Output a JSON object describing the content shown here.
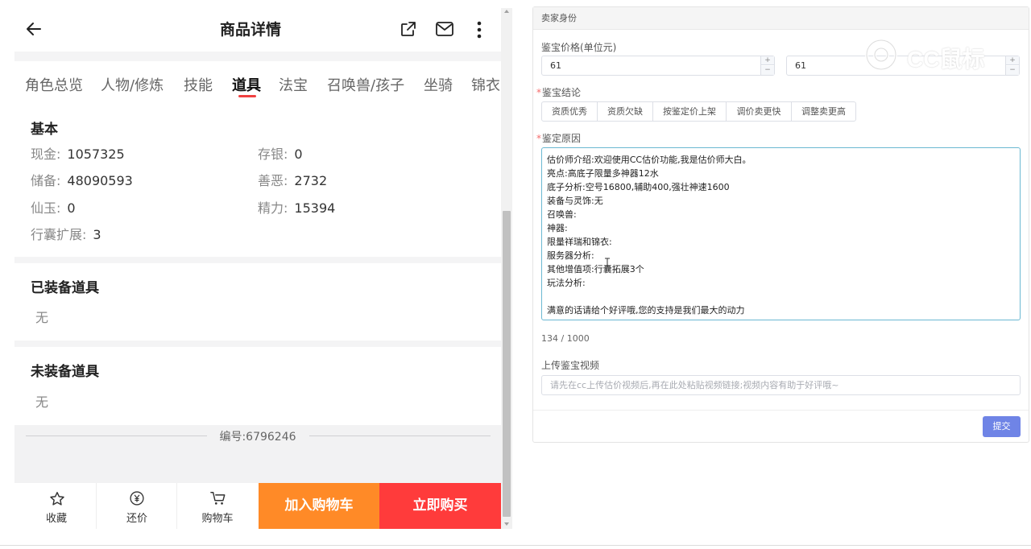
{
  "mobile": {
    "header": {
      "title": "商品详情"
    },
    "tabs": [
      {
        "label": "角色总览"
      },
      {
        "label": "人物/修炼"
      },
      {
        "label": "技能"
      },
      {
        "label": "道具"
      },
      {
        "label": "法宝"
      },
      {
        "label": "召唤兽/孩子"
      },
      {
        "label": "坐骑"
      },
      {
        "label": "锦衣"
      }
    ],
    "active_tab": "道具",
    "basic": {
      "title": "基本",
      "items": [
        {
          "label": "现金:",
          "value": "1057325"
        },
        {
          "label": "存银:",
          "value": "0"
        },
        {
          "label": "储备:",
          "value": "48090593"
        },
        {
          "label": "善恶:",
          "value": "2732"
        },
        {
          "label": "仙玉:",
          "value": "0"
        },
        {
          "label": "精力:",
          "value": "15394"
        },
        {
          "label": "行囊扩展:",
          "value": "3"
        }
      ]
    },
    "equipped": {
      "title": "已装备道具",
      "empty": "无"
    },
    "unequipped": {
      "title": "未装备道具",
      "empty": "无"
    },
    "serial": "编号:6796246",
    "bottom_bar": {
      "favorite": "收藏",
      "bargain": "还价",
      "cart": "购物车",
      "add_to_cart": "加入购物车",
      "buy_now": "立即购买"
    }
  },
  "form": {
    "panel_title": "卖家身份",
    "price_label": "鉴宝价格(单位元)",
    "price_min": "61",
    "price_max": "61",
    "conclusion_label": "鉴宝结论",
    "conclusion_options": [
      "资质优秀",
      "资质欠缺",
      "按鉴定价上架",
      "调价卖更快",
      "调整卖更高"
    ],
    "reason_label": "鉴定原因",
    "reason_lines": [
      "估价师介绍:欢迎使用CC估价功能,我是估价师大白。",
      "亮点:高底子限量多神器12水",
      "底子分析:空号16800,辅助400,强壮神速1600",
      "装备与灵饰:无",
      "召唤兽:",
      "神器:",
      "限量祥瑞和锦衣:",
      "服务器分析:",
      "其他增值项:行囊拓展3个",
      "玩法分析:",
      "",
      "满意的话请给个好评哦,您的支持是我们最大的动力"
    ],
    "counter": "134 / 1000",
    "video_label": "上传鉴宝视频",
    "video_placeholder": "请先在cc上传估价视频后,再在此处粘贴视频链接;视频内容有助于好评哦~",
    "submit": "提交"
  },
  "watermark": "CC鼠标",
  "colors": {
    "accent_red": "#f04040",
    "cart_orange": "#ff8a27",
    "buy_red": "#ff3b3b",
    "submit_blue": "#6f84e6",
    "textarea_border": "#6bb8d2"
  }
}
